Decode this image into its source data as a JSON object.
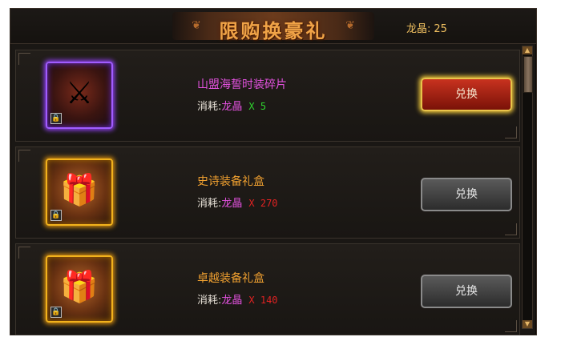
{
  "header": {
    "title": "限购换豪礼",
    "currency_label": "龙晶:",
    "currency_value": "25"
  },
  "items": [
    {
      "name": "山盟海誓时装碎片",
      "name_color": "#e452e0",
      "cost_label": "消耗:",
      "cost_currency": "龙晶",
      "cost_amount": "X 5",
      "cost_color": "#2fd42f",
      "rarity": "epic",
      "icon_name": "armor-fashion-icon",
      "button_label": "兑换",
      "button_state": "active"
    },
    {
      "name": "史诗装备礼盒",
      "name_color": "#f0a030",
      "cost_label": "消耗:",
      "cost_currency": "龙晶",
      "cost_amount": "X 270",
      "cost_color": "#e02222",
      "rarity": "legendary",
      "icon_name": "gift-box-icon",
      "button_label": "兑换",
      "button_state": "disabled"
    },
    {
      "name": "卓越装备礼盒",
      "name_color": "#f0a030",
      "cost_label": "消耗:",
      "cost_currency": "龙晶",
      "cost_amount": "X 140",
      "cost_color": "#e02222",
      "rarity": "legendary",
      "icon_name": "gift-box-icon",
      "button_label": "兑换",
      "button_state": "disabled"
    }
  ],
  "colors": {
    "title": "#f0a347",
    "currency_name": "#e452e0",
    "active_button": "#c8321f",
    "active_border": "#e8c44a"
  }
}
